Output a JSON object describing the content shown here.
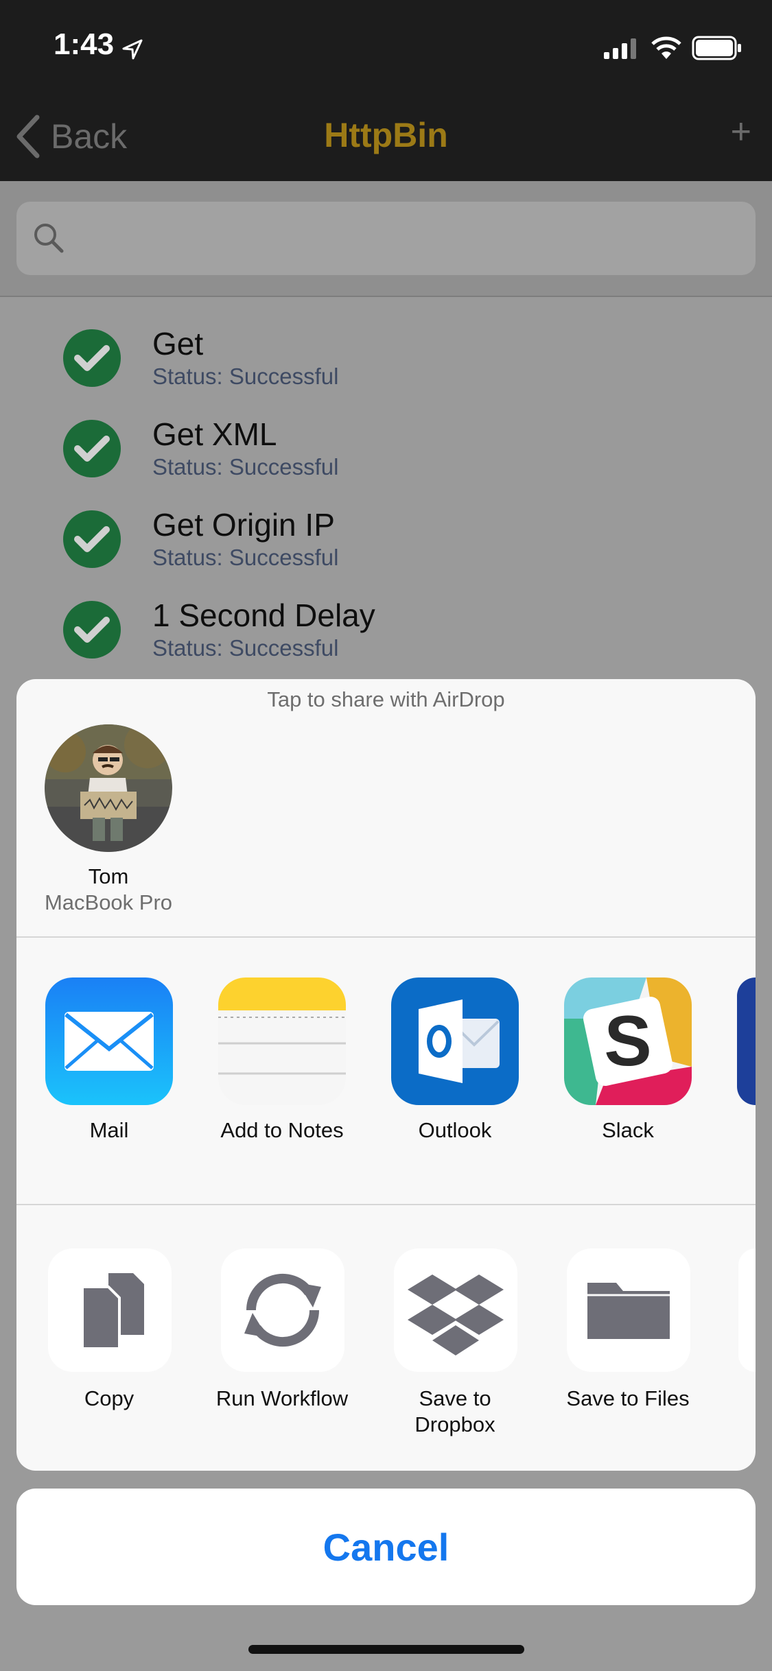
{
  "status_bar": {
    "time": "1:43"
  },
  "nav": {
    "back_label": "Back",
    "title": "HttpBin",
    "add_label": "+"
  },
  "search": {
    "placeholder": ""
  },
  "requests": [
    {
      "name": "Get",
      "status": "Status: Successful"
    },
    {
      "name": "Get XML",
      "status": "Status: Successful"
    },
    {
      "name": "Get Origin IP",
      "status": "Status: Successful"
    },
    {
      "name": "1 Second Delay",
      "status": "Status: Successful"
    }
  ],
  "share_sheet": {
    "airdrop_hint": "Tap to share with AirDrop",
    "airdrop_contact": {
      "name": "Tom",
      "device": "MacBook Pro"
    },
    "apps": [
      {
        "label": "Mail",
        "icon": "mail-icon"
      },
      {
        "label": "Add to Notes",
        "icon": "notes-icon"
      },
      {
        "label": "Outlook",
        "icon": "outlook-icon"
      },
      {
        "label": "Slack",
        "icon": "slack-icon"
      }
    ],
    "actions": [
      {
        "label": "Copy",
        "icon": "copy-icon"
      },
      {
        "label": "Run Workflow",
        "icon": "workflow-icon"
      },
      {
        "label": "Save to Dropbox",
        "icon": "dropbox-icon"
      },
      {
        "label": "Save to Files",
        "icon": "folder-icon"
      }
    ],
    "cancel_label": "Cancel"
  },
  "colors": {
    "accent": "#1477ee",
    "nav_title": "#9c7a16",
    "success": "#1b6b38"
  }
}
